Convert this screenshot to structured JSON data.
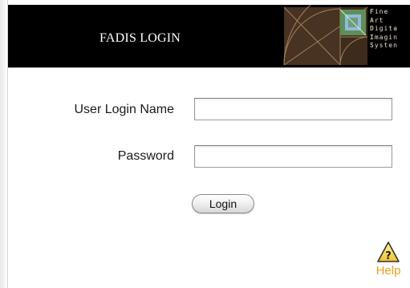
{
  "header": {
    "title": "FADIS LOGIN",
    "logo": {
      "lines": [
        {
          "initial": "F",
          "rest": "ine"
        },
        {
          "initial": "A",
          "rest": "rt"
        },
        {
          "initial": "D",
          "rest": "igita"
        },
        {
          "initial": "I",
          "rest": "magin"
        },
        {
          "initial": "S",
          "rest": "ysten"
        }
      ]
    }
  },
  "form": {
    "username": {
      "label": "User Login Name",
      "value": "",
      "placeholder": ""
    },
    "password": {
      "label": "Password",
      "value": "",
      "placeholder": ""
    },
    "submit_label": "Login"
  },
  "help": {
    "label": "Help",
    "icon": "help-warning-icon"
  },
  "colors": {
    "header_background": "#000000",
    "header_text": "#ffffff",
    "help_accent": "#e8a21b"
  }
}
